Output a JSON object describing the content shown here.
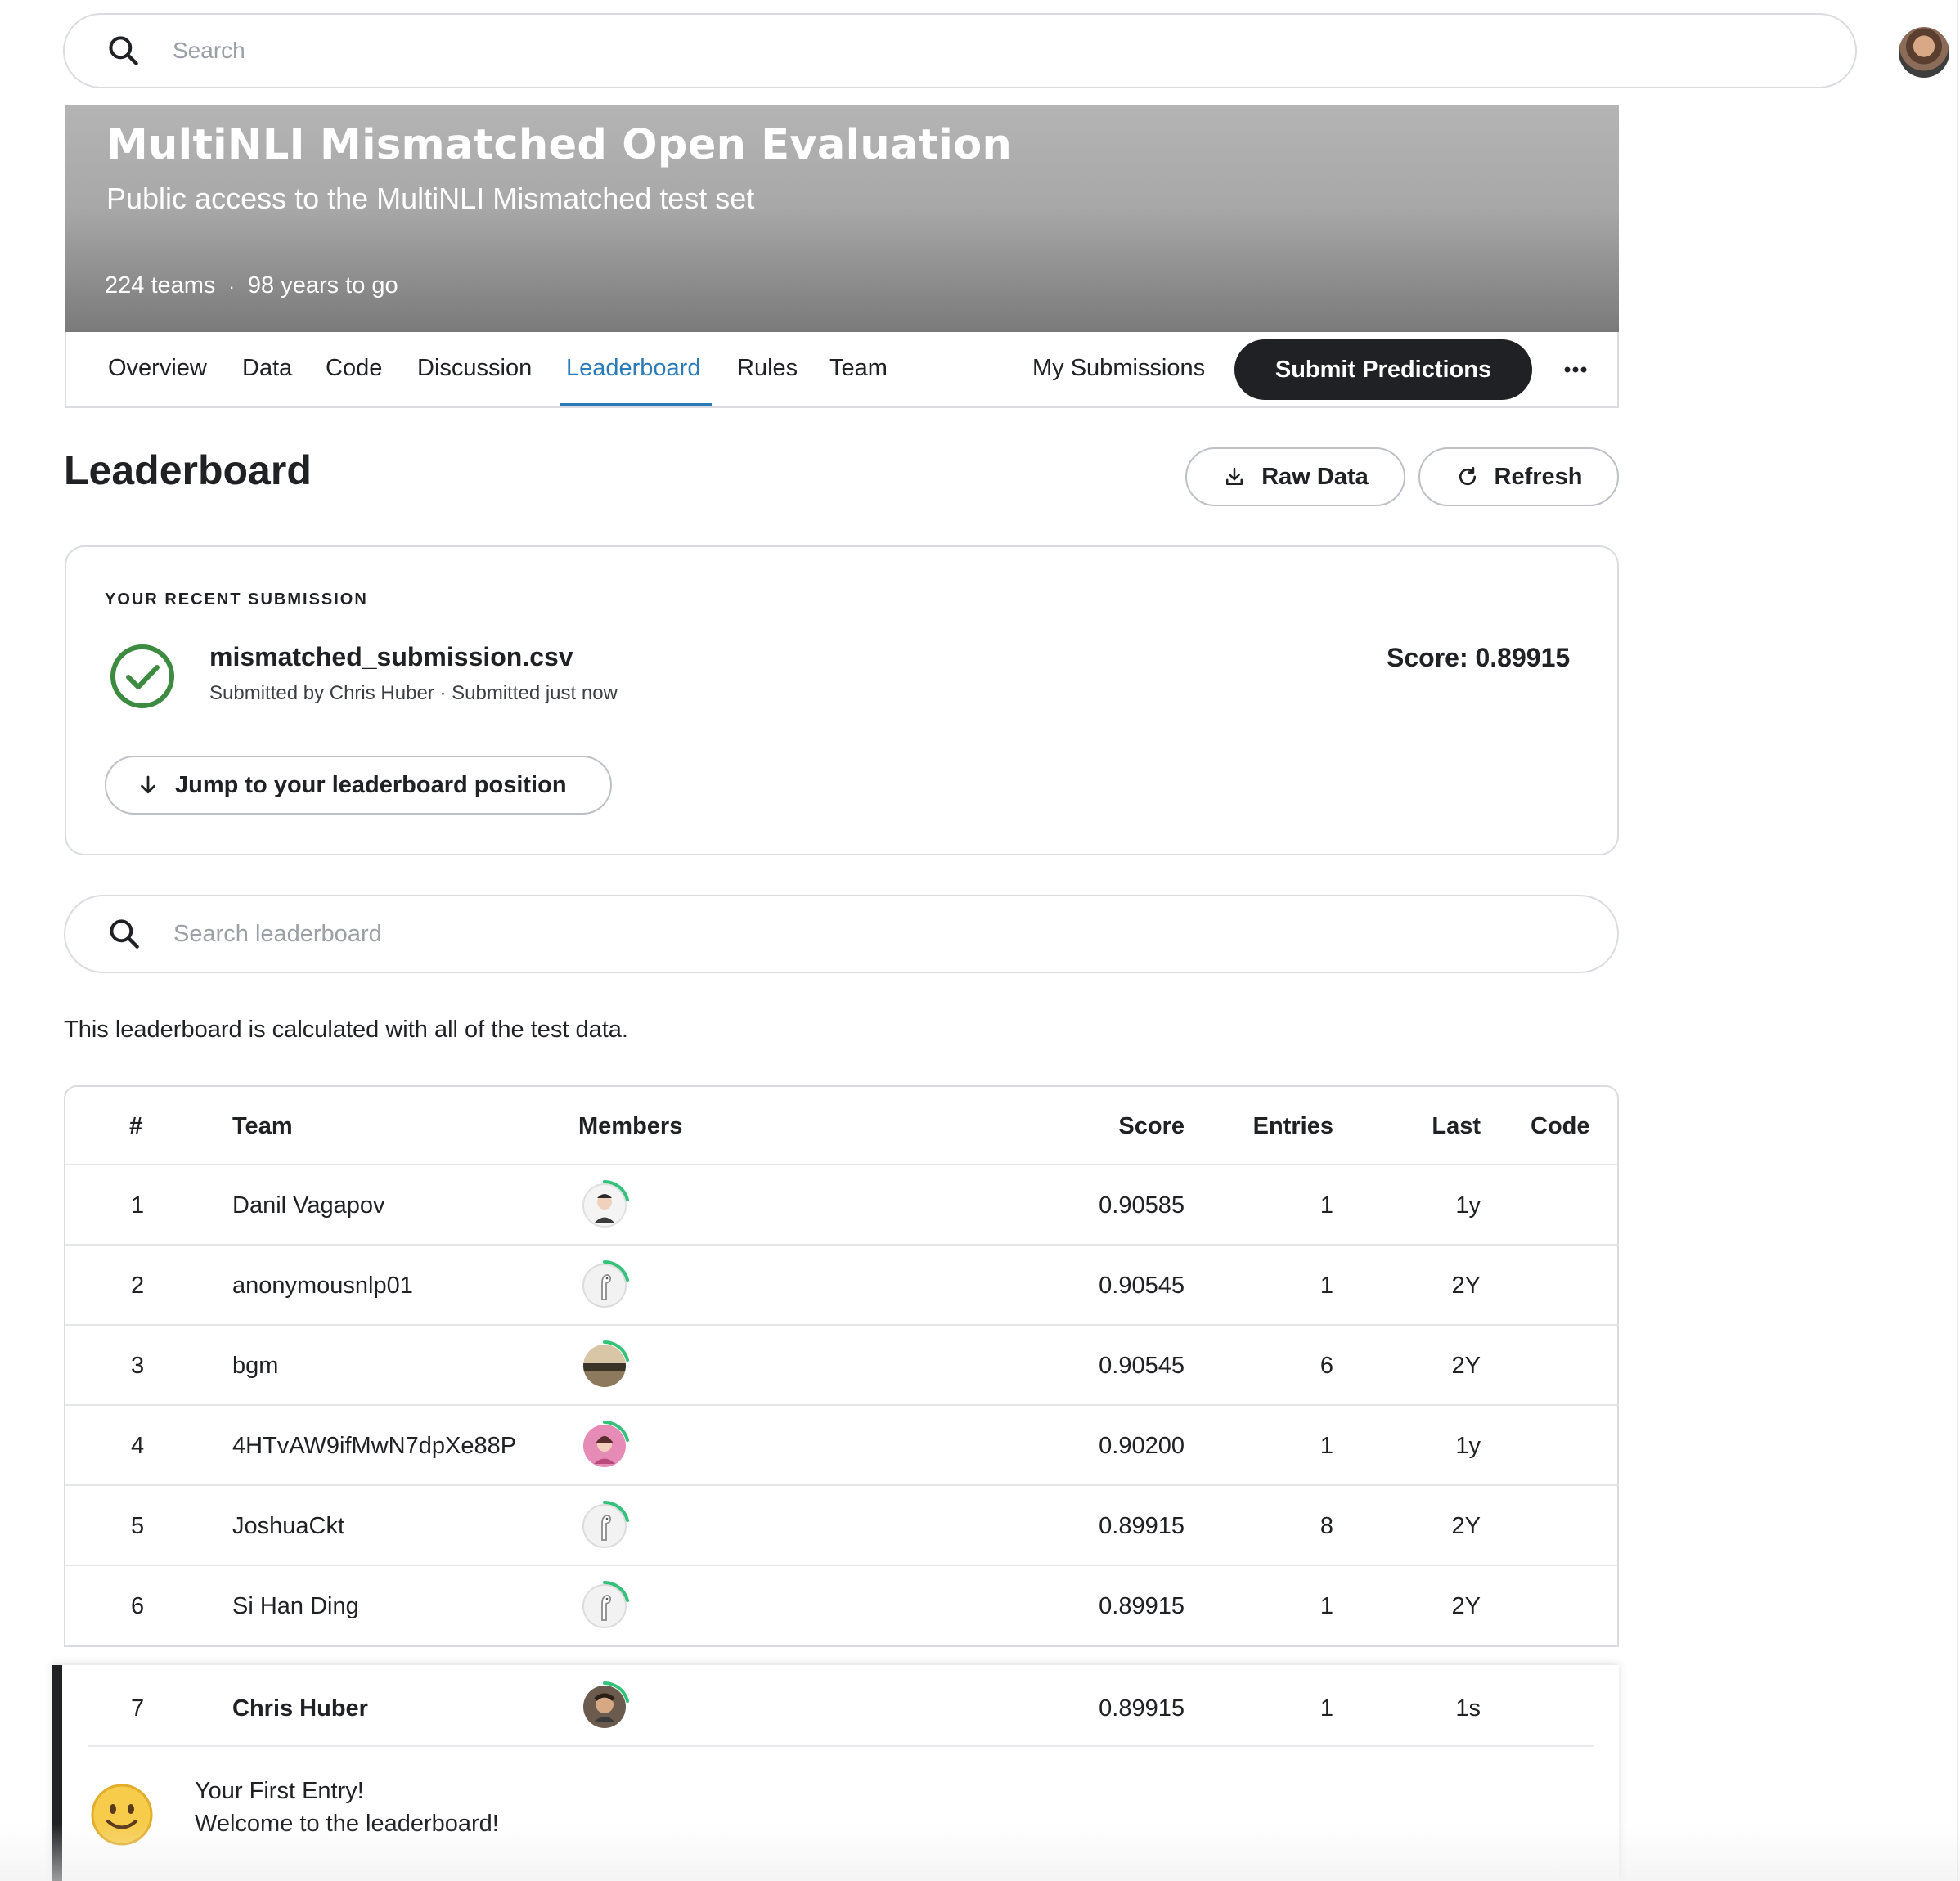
{
  "topbar": {
    "search_placeholder": "Search",
    "avatar_icon": "user-avatar"
  },
  "competition": {
    "title": "MultiNLI Mismatched Open Evaluation",
    "subtitle": "Public access to the MultiNLI Mismatched test set",
    "teams": "224 teams",
    "separator": "·",
    "time_left": "98 years to go"
  },
  "tabs": [
    {
      "label": "Overview",
      "active": false
    },
    {
      "label": "Data",
      "active": false
    },
    {
      "label": "Code",
      "active": false
    },
    {
      "label": "Discussion",
      "active": false
    },
    {
      "label": "Leaderboard",
      "active": true
    },
    {
      "label": "Rules",
      "active": false
    },
    {
      "label": "Team",
      "active": false
    }
  ],
  "actions": {
    "my_submissions": "My Submissions",
    "submit_predictions": "Submit Predictions",
    "more_icon": "more-horizontal-icon"
  },
  "leaderboard": {
    "title": "Leaderboard",
    "raw_data": "Raw Data",
    "refresh": "Refresh",
    "search_placeholder": "Search leaderboard",
    "note": "This leaderboard is calculated with all of the test data."
  },
  "recent_submission": {
    "label": "YOUR RECENT SUBMISSION",
    "file_name": "mismatched_submission.csv",
    "meta": "Submitted by Chris Huber · Submitted just now",
    "score": "Score: 0.89915",
    "jump_label": "Jump to your leaderboard position",
    "status_color": "#3d8b40"
  },
  "table": {
    "headers": {
      "rank": "#",
      "team": "Team",
      "members": "Members",
      "score": "Score",
      "entries": "Entries",
      "last": "Last",
      "code": "Code"
    },
    "rows": [
      {
        "rank": "1",
        "team": "Danil Vagapov",
        "score": "0.90585",
        "entries": "1",
        "last": "1y",
        "avatar": "person"
      },
      {
        "rank": "2",
        "team": "anonymousnlp01",
        "score": "0.90545",
        "entries": "1",
        "last": "2Y",
        "avatar": "default-goose"
      },
      {
        "rank": "3",
        "team": "bgm",
        "score": "0.90545",
        "entries": "6",
        "last": "2Y",
        "avatar": "landscape"
      },
      {
        "rank": "4",
        "team": "4HTvAW9ifMwN7dpXe88P",
        "score": "0.90200",
        "entries": "1",
        "last": "1y",
        "avatar": "pink-portrait"
      },
      {
        "rank": "5",
        "team": "JoshuaCkt",
        "score": "0.89915",
        "entries": "8",
        "last": "2Y",
        "avatar": "default-goose"
      },
      {
        "rank": "6",
        "team": "Si Han Ding",
        "score": "0.89915",
        "entries": "1",
        "last": "2Y",
        "avatar": "default-goose"
      }
    ],
    "my_row": {
      "rank": "7",
      "team": "Chris Huber",
      "score": "0.89915",
      "entries": "1",
      "last": "1s",
      "avatar": "person"
    }
  },
  "first_entry": {
    "line1": "Your First Entry!",
    "line2": "Welcome to the leaderboard!",
    "icon": "smiley-icon"
  },
  "colors": {
    "accent": "#2b7bb9",
    "primary_button": "#202124",
    "progress_arc": "#34c27a"
  }
}
